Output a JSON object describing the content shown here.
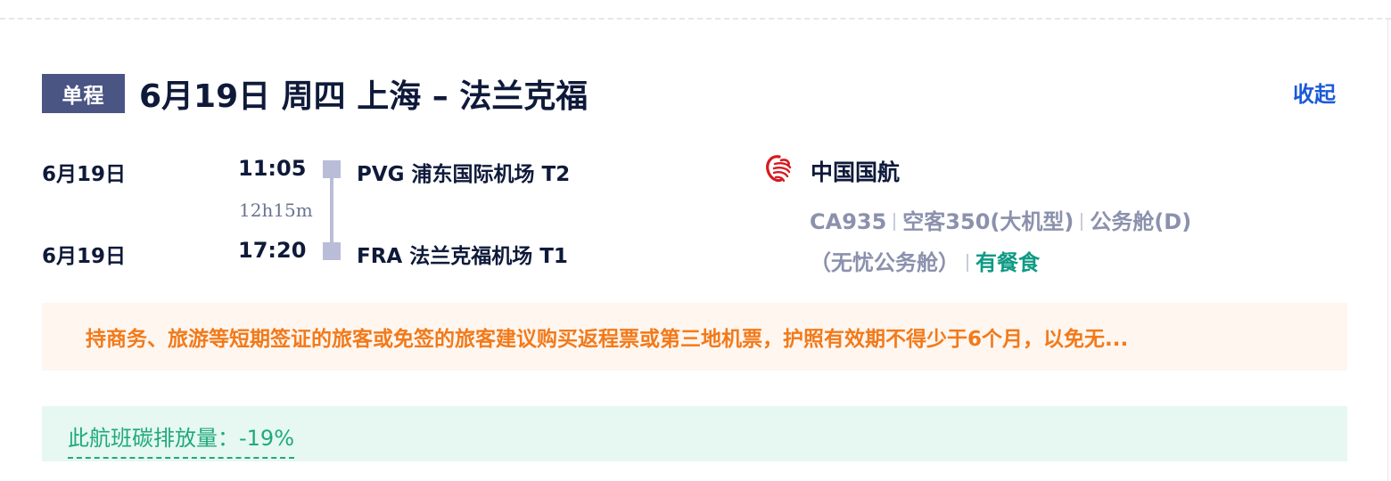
{
  "header": {
    "trip_type": "单程",
    "route_title": "6月19日 周四 上海 – 法兰克福",
    "collapse_label": "收起"
  },
  "segment": {
    "departure": {
      "date": "6月19日",
      "time": "11:05",
      "airport": "PVG 浦东国际机场 T2"
    },
    "duration": "12h15m",
    "arrival": {
      "date": "6月19日",
      "time": "17:20",
      "airport": "FRA 法兰克福机场 T1"
    }
  },
  "airline": {
    "logo_icon": "air-china-phoenix-icon",
    "name": "中国国航",
    "flight_no": "CA935",
    "aircraft": "空客350(大机型)",
    "cabin": "公务舱(D)",
    "fare_name": "（无忧公务舱）",
    "meal": "有餐食"
  },
  "notice": {
    "text": "持商务、旅游等短期签证的旅客或免签的旅客建议购买返程票或第三地机票，护照有效期不得少于6个月，以免无..."
  },
  "carbon": {
    "label": "此航班碳排放量：-19%"
  },
  "colors": {
    "badge": "#4a5584",
    "link": "#1a5ad8",
    "notice_text": "#f27a1a",
    "notice_bg": "#fff6f0",
    "carbon_text": "#20a97c",
    "carbon_bg": "#e6f8f1",
    "meal": "#0f9a84",
    "brand_red": "#d71920"
  }
}
